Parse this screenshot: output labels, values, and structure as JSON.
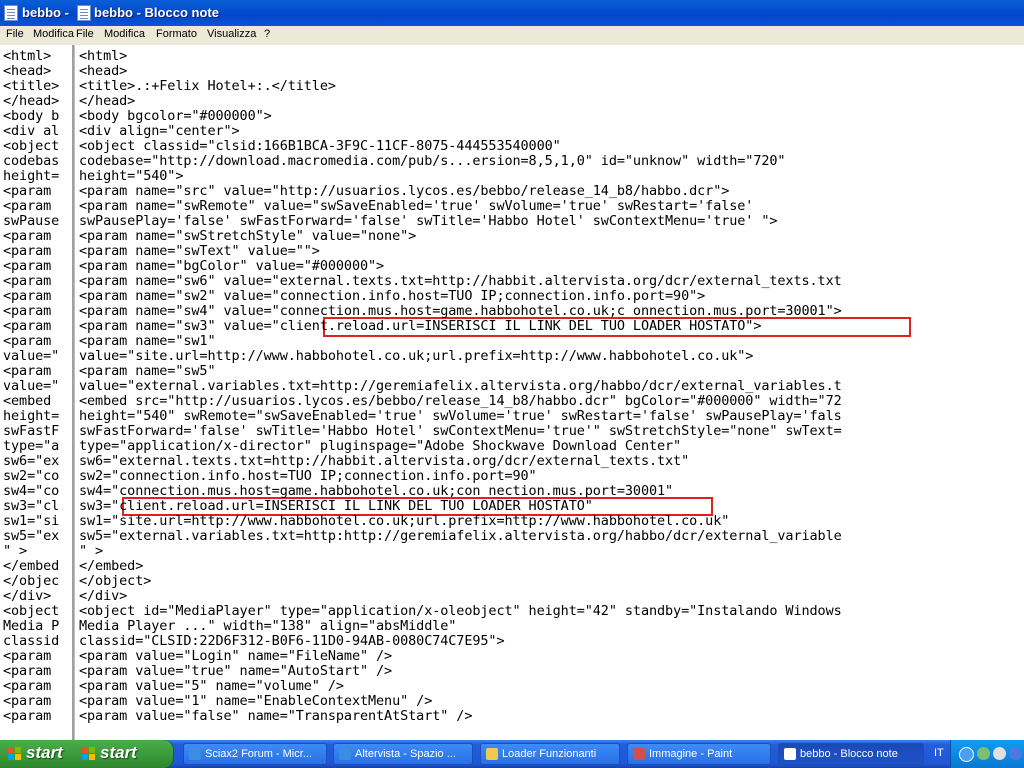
{
  "back_window": {
    "title": "bebbo -",
    "menu": [
      "File",
      "Modifica"
    ],
    "lines": [
      "<html>",
      "<head>",
      "<title>",
      "</head>",
      "<body b",
      "<div al",
      "<object",
      "codebas",
      "height=",
      "<param",
      "<param",
      "swPause",
      "<param",
      "<param",
      "<param",
      "<param",
      "<param",
      "<param",
      "<param",
      "<param",
      "value=\"",
      "<param",
      "value=\"",
      "<embed",
      "height=",
      "swFastF",
      "type=\"a",
      "sw6=\"ex",
      "sw2=\"co",
      "sw4=\"co",
      "sw3=\"cl",
      "sw1=\"si",
      "sw5=\"ex",
      "\" >",
      "</embed",
      "</objec",
      "</div>",
      "<object",
      "Media P",
      "classid",
      "<param",
      "<param",
      "<param",
      "<param",
      "<param"
    ]
  },
  "front_window": {
    "title": "bebbo - Blocco note",
    "menu": [
      "File",
      "Modifica",
      "Formato",
      "Visualizza",
      "?"
    ],
    "lines": [
      "<html>",
      "<head>",
      "<title>.:+Felix Hotel+:.</title>",
      "</head>",
      "<body bgcolor=\"#000000\">",
      "<div align=\"center\">",
      "<object classid=\"clsid:166B1BCA-3F9C-11CF-8075-444553540000\"",
      "codebase=\"http://download.macromedia.com/pub/s...ersion=8,5,1,0\" id=\"unknow\" width=\"720\"",
      "height=\"540\">",
      "<param name=\"src\" value=\"http://usuarios.lycos.es/bebbo/release_14_b8/habbo.dcr\">",
      "<param name=\"swRemote\" value=\"swSaveEnabled='true' swVolume='true' swRestart='false'",
      "swPausePlay='false' swFastForward='false' swTitle='Habbo Hotel' swContextMenu='true' \">",
      "<param name=\"swStretchStyle\" value=\"none\">",
      "<param name=\"swText\" value=\"\">",
      "<param name=\"bgColor\" value=\"#000000\">",
      "<param name=\"sw6\" value=\"external.texts.txt=http://habbit.altervista.org/dcr/external_texts.txt",
      "<param name=\"sw2\" value=\"connection.info.host=TUO IP;connection.info.port=90\">",
      "<param name=\"sw4\" value=\"connection.mus.host=game.habbohotel.co.uk;c onnection.mus.port=30001\">",
      "<param name=\"sw3\" value=\"client.reload.url=INSERISCI IL LINK DEL TUO LOADER HOSTATO\">",
      "<param name=\"sw1\"",
      "value=\"site.url=http://www.habbohotel.co.uk;url.prefix=http://www.habbohotel.co.uk\">",
      "<param name=\"sw5\"",
      "value=\"external.variables.txt=http://geremiafelix.altervista.org/habbo/dcr/external_variables.t",
      "<embed src=\"http://usuarios.lycos.es/bebbo/release_14_b8/habbo.dcr\" bgColor=\"#000000\" width=\"72",
      "height=\"540\" swRemote=\"swSaveEnabled='true' swVolume='true' swRestart='false' swPausePlay='fals",
      "swFastForward='false' swTitle='Habbo Hotel' swContextMenu='true'\" swStretchStyle=\"none\" swText=",
      "type=\"application/x-director\" pluginspage=\"Adobe Shockwave Download Center\"",
      "sw6=\"external.texts.txt=http://habbit.altervista.org/dcr/external_texts.txt\"",
      "sw2=\"connection.info.host=TUO IP;connection.info.port=90\"",
      "sw4=\"connection.mus.host=game.habbohotel.co.uk;con nection.mus.port=30001\"",
      "sw3=\"client.reload.url=INSERISCI IL LINK DEL TUO LOADER HOSTATO\"",
      "sw1=\"site.url=http://www.habbohotel.co.uk;url.prefix=http://www.habbohotel.co.uk\"",
      "sw5=\"external.variables.txt=http:http://geremiafelix.altervista.org/habbo/dcr/external_variable",
      "\" >",
      "</embed>",
      "</object>",
      "</div>",
      "<object id=\"MediaPlayer\" type=\"application/x-oleobject\" height=\"42\" standby=\"Instalando Windows",
      "Media Player ...\" width=\"138\" align=\"absMiddle\"",
      "classid=\"CLSID:22D6F312-B0F6-11D0-94AB-0080C74C7E95\">",
      "<param value=\"Login\" name=\"FileName\" />",
      "<param value=\"true\" name=\"AutoStart\" />",
      "<param value=\"5\" name=\"volume\" />",
      "<param value=\"1\" name=\"EnableContextMenu\" />",
      "<param value=\"false\" name=\"TransparentAtStart\" />"
    ]
  },
  "taskbar": {
    "start_label": "start",
    "tasks": [
      {
        "label": "Sciax2 Forum - Micr...",
        "icon": "ie-icon",
        "color": "#3a8de0"
      },
      {
        "label": "Altervista - Spazio ...",
        "icon": "ie-icon",
        "color": "#3a8de0"
      },
      {
        "label": "Loader Funzionanti",
        "icon": "folder-icon",
        "color": "#f0c850"
      },
      {
        "label": "Immagine - Paint",
        "icon": "paint-icon",
        "color": "#d05050"
      },
      {
        "label": "bebbo - Blocco note",
        "icon": "notepad-icon",
        "color": "#ffffff"
      }
    ],
    "language": "IT"
  },
  "colors": {
    "title_blue": "#0a5fd8",
    "highlight_box": "#d22222",
    "taskbar_blue": "#245edb",
    "start_green": "#3c9c3c"
  }
}
